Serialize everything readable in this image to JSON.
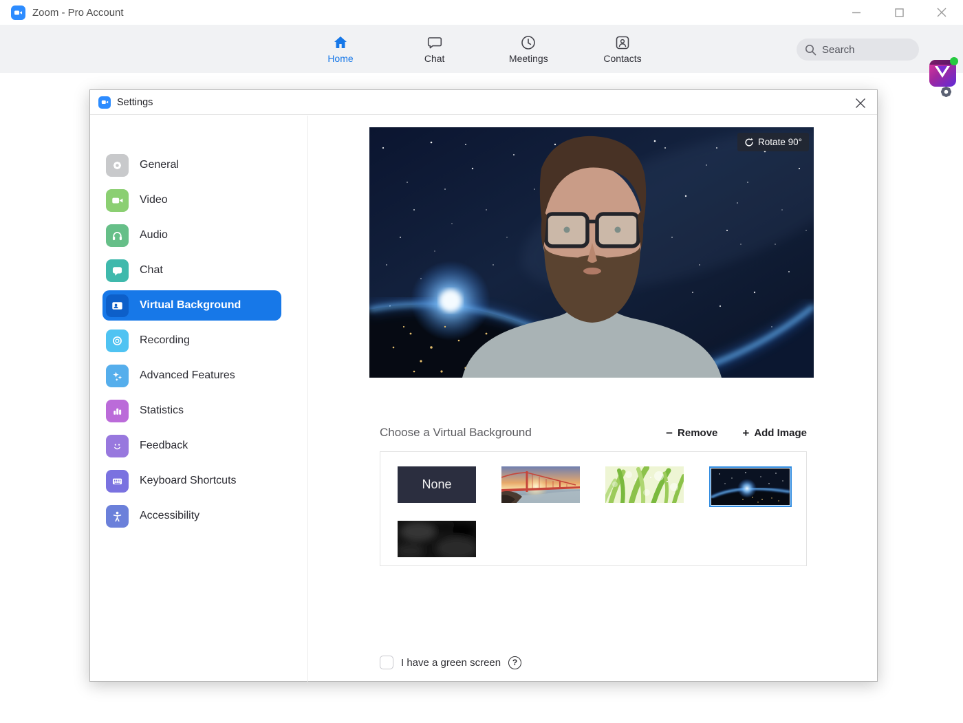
{
  "window": {
    "title": "Zoom - Pro Account"
  },
  "nav": {
    "tabs": [
      {
        "label": "Home",
        "active": true
      },
      {
        "label": "Chat",
        "active": false
      },
      {
        "label": "Meetings",
        "active": false
      },
      {
        "label": "Contacts",
        "active": false
      }
    ],
    "search": {
      "placeholder": "Search"
    }
  },
  "colors": {
    "accent_blue": "#1778e8",
    "zoom_brand_blue": "#2D8CFF",
    "nav_bg": "#f1f2f4",
    "online_status_green": "#25c93f",
    "selected_thumb_border": "#2f8be0"
  },
  "dialog": {
    "title": "Settings",
    "sidebar": {
      "items": [
        {
          "label": "General",
          "icon": "gear-icon",
          "color": "#c8c9cb"
        },
        {
          "label": "Video",
          "icon": "video-camera-icon",
          "color": "#8bcf72"
        },
        {
          "label": "Audio",
          "icon": "headphones-icon",
          "color": "#66bf88"
        },
        {
          "label": "Chat",
          "icon": "chat-bubble-icon",
          "color": "#3fb9ac"
        },
        {
          "label": "Virtual Background",
          "icon": "person-card-icon",
          "color": "#0d5fc9",
          "selected": true
        },
        {
          "label": "Recording",
          "icon": "record-icon",
          "color": "#4fc3f2"
        },
        {
          "label": "Advanced Features",
          "icon": "sparkles-icon",
          "color": "#55aeec"
        },
        {
          "label": "Statistics",
          "icon": "bar-chart-icon",
          "color": "#bb6bd9"
        },
        {
          "label": "Feedback",
          "icon": "smiley-icon",
          "color": "#9878de"
        },
        {
          "label": "Keyboard Shortcuts",
          "icon": "keyboard-icon",
          "color": "#7a72e0"
        },
        {
          "label": "Accessibility",
          "icon": "accessibility-icon",
          "color": "#6b80da"
        }
      ]
    },
    "preview": {
      "rotate_button": "Rotate 90°"
    },
    "chooser": {
      "heading": "Choose a Virtual Background",
      "remove_glyph": "−",
      "remove_label": "Remove",
      "add_glyph": "+",
      "add_label": "Add Image"
    },
    "thumbnails": [
      {
        "name": "none",
        "label": "None",
        "selected": false
      },
      {
        "name": "golden-gate-bridge",
        "selected": false
      },
      {
        "name": "grass",
        "selected": false
      },
      {
        "name": "earth-from-space",
        "selected": true
      },
      {
        "name": "dark-blur",
        "selected": false
      }
    ],
    "green_screen": {
      "label": "I have a green screen",
      "checked": false
    }
  }
}
